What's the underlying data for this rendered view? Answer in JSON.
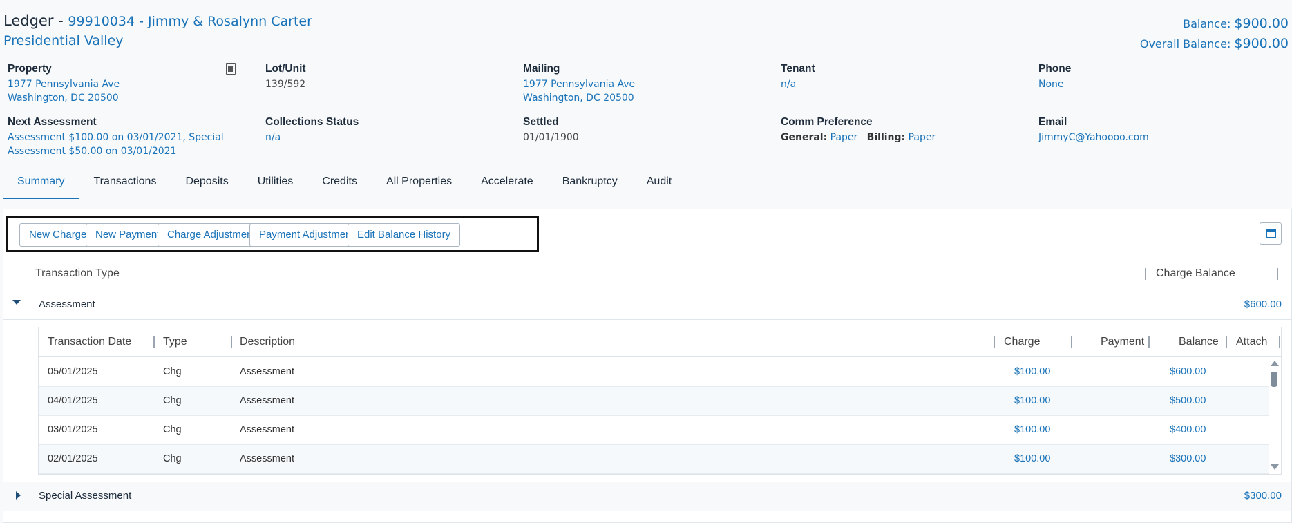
{
  "header": {
    "title_prefix": "Ledger - ",
    "account": "99910034 - Jimmy & Rosalynn Carter",
    "community": "Presidential Valley",
    "balance_label": "Balance:",
    "balance_value": "$900.00",
    "overall_label": "Overall Balance:",
    "overall_value": "$900.00"
  },
  "info": {
    "property": {
      "label": "Property",
      "line1": "1977 Pennsylvania Ave",
      "line2": "Washington, DC 20500"
    },
    "lot": {
      "label": "Lot/Unit",
      "value": "139/592"
    },
    "mailing": {
      "label": "Mailing",
      "line1": "1977 Pennsylvania Ave",
      "line2": "Washington, DC 20500"
    },
    "tenant": {
      "label": "Tenant",
      "value": "n/a"
    },
    "phone": {
      "label": "Phone",
      "value": "None"
    },
    "next_assessment": {
      "label": "Next Assessment",
      "line1": "Assessment $100.00 on 03/01/2021, Special",
      "line2": "Assessment $50.00 on 03/01/2021"
    },
    "collections": {
      "label": "Collections Status",
      "value": "n/a"
    },
    "settled": {
      "label": "Settled",
      "value": "01/01/1900"
    },
    "comm": {
      "label": "Comm Preference",
      "general_label": "General:",
      "general_value": "Paper",
      "billing_label": "Billing:",
      "billing_value": "Paper"
    },
    "email": {
      "label": "Email",
      "value": "JimmyC@Yahoooo.com"
    }
  },
  "tabs": [
    "Summary",
    "Transactions",
    "Deposits",
    "Utilities",
    "Credits",
    "All Properties",
    "Accelerate",
    "Bankruptcy",
    "Audit"
  ],
  "toolbar": {
    "new_charge": "New Charge",
    "new_payment": "New Payment",
    "charge_adjustment": "Charge Adjustment",
    "payment_adjustment": "Payment Adjustment",
    "edit_balance_history": "Edit Balance History"
  },
  "grid": {
    "col_type": "Transaction Type",
    "col_balance": "Charge Balance",
    "groups": [
      {
        "name": "Assessment",
        "amount": "$600.00"
      },
      {
        "name": "Special Assessment",
        "amount": "$300.00"
      }
    ]
  },
  "subgrid": {
    "headers": [
      "Transaction Date",
      "Type",
      "Description",
      "Charge",
      "Payment",
      "Balance",
      "Attach"
    ],
    "rows": [
      {
        "date": "05/01/2025",
        "type": "Chg",
        "desc": "Assessment",
        "charge": "$100.00",
        "payment": "",
        "balance": "$600.00"
      },
      {
        "date": "04/01/2025",
        "type": "Chg",
        "desc": "Assessment",
        "charge": "$100.00",
        "payment": "",
        "balance": "$500.00"
      },
      {
        "date": "03/01/2025",
        "type": "Chg",
        "desc": "Assessment",
        "charge": "$100.00",
        "payment": "",
        "balance": "$400.00"
      },
      {
        "date": "02/01/2025",
        "type": "Chg",
        "desc": "Assessment",
        "charge": "$100.00",
        "payment": "",
        "balance": "$300.00"
      }
    ]
  },
  "colors": {
    "accent": "#1a73b8",
    "text": "#1d2b3a",
    "highlight_border": "#111111"
  }
}
